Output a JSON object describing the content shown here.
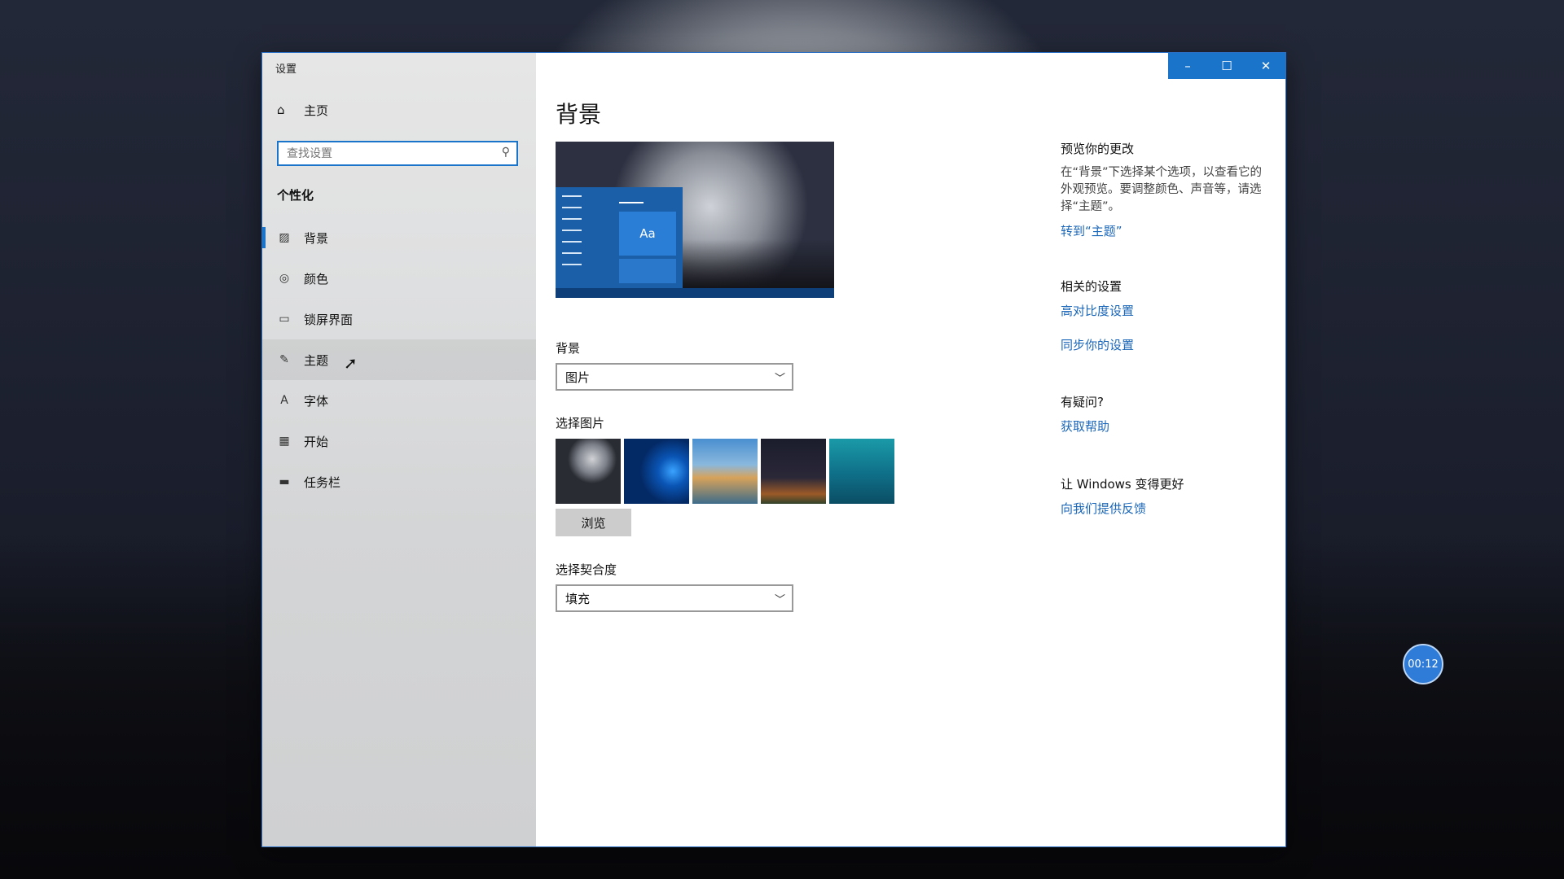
{
  "window": {
    "title": "设置",
    "controls": [
      "minimize",
      "maximize",
      "close"
    ]
  },
  "sidebar": {
    "home_label": "主页",
    "search_placeholder": "查找设置",
    "section_title": "个性化",
    "items": [
      {
        "label": "背景",
        "icon": "picture-icon",
        "active": true
      },
      {
        "label": "颜色",
        "icon": "palette-icon"
      },
      {
        "label": "锁屏界面",
        "icon": "lock-screen-icon"
      },
      {
        "label": "主题",
        "icon": "theme-brush-icon",
        "hover": true
      },
      {
        "label": "字体",
        "icon": "font-icon"
      },
      {
        "label": "开始",
        "icon": "start-icon"
      },
      {
        "label": "任务栏",
        "icon": "taskbar-icon"
      }
    ]
  },
  "main": {
    "title": "背景",
    "preview_tile_text": "Aa",
    "background_label": "背景",
    "background_value": "图片",
    "choose_picture_label": "选择图片",
    "browse_label": "浏览",
    "fit_label": "选择契合度",
    "fit_value": "填充"
  },
  "aside": {
    "preview_title": "预览你的更改",
    "preview_text": "在“背景”下选择某个选项，以查看它的外观预览。要调整颜色、声音等，请选择“主题”。",
    "preview_link": "转到“主题”",
    "related_title": "相关的设置",
    "related_links": [
      "高对比度设置",
      "同步你的设置"
    ],
    "help_title": "有疑问?",
    "help_link": "获取帮助",
    "feedback_title": "让 Windows 变得更好",
    "feedback_link": "向我们提供反馈"
  },
  "overlay": {
    "timer": "00:12"
  },
  "colors": {
    "accent": "#1a74c9",
    "link": "#1a66b8"
  }
}
